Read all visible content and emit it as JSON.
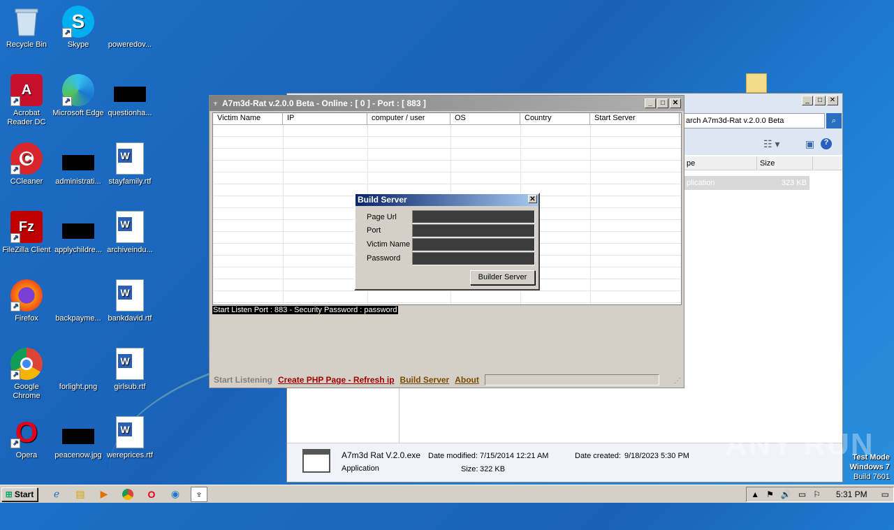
{
  "desktop": {
    "icons": [
      {
        "id": "recycle-bin",
        "label": "Recycle Bin"
      },
      {
        "id": "skype",
        "label": "Skype"
      },
      {
        "id": "poweredov",
        "label": "poweredov..."
      },
      {
        "id": "acrobat",
        "label": "Acrobat Reader DC"
      },
      {
        "id": "edge",
        "label": "Microsoft Edge"
      },
      {
        "id": "questionha",
        "label": "questionha..."
      },
      {
        "id": "ccleaner",
        "label": "CCleaner"
      },
      {
        "id": "administrati",
        "label": "administrati..."
      },
      {
        "id": "stayfamily",
        "label": "stayfamily.rtf"
      },
      {
        "id": "filezilla",
        "label": "FileZilla Client"
      },
      {
        "id": "applychildre",
        "label": "applychildre..."
      },
      {
        "id": "archiveindu",
        "label": "archiveindu..."
      },
      {
        "id": "firefox",
        "label": "Firefox"
      },
      {
        "id": "backpayme",
        "label": "backpayme..."
      },
      {
        "id": "bankdavid",
        "label": "bankdavid.rtf"
      },
      {
        "id": "chrome",
        "label": "Google Chrome"
      },
      {
        "id": "forlight",
        "label": "forlight.png"
      },
      {
        "id": "girlsub",
        "label": "girlsub.rtf"
      },
      {
        "id": "opera",
        "label": "Opera"
      },
      {
        "id": "peacenow",
        "label": "peacenow.jpg"
      },
      {
        "id": "wereprices",
        "label": "wereprices.rtf"
      }
    ]
  },
  "explorer": {
    "search_placeholder": "arch A7m3d-Rat v.2.0.0 Beta",
    "col_type": "pe",
    "col_size": "Size",
    "row_type": "plication",
    "row_size": "323 KB",
    "details": {
      "name": "A7m3d Rat V.2.0.exe",
      "type": "Application",
      "date_modified_label": "Date modified:",
      "date_modified": "7/15/2014 12:21 AM",
      "size_label": "Size:",
      "size": "322 KB",
      "date_created_label": "Date created:",
      "date_created": "9/18/2023 5:30 PM"
    }
  },
  "rat": {
    "title": "A7m3d-Rat v.2.0.0 Beta - Online : [ 0 ] - Port : [ 883 ]",
    "columns": [
      "Victim Name",
      "IP",
      "computer / user",
      "OS",
      "Country",
      "Start Server"
    ],
    "status": "Start Listen Port : 883 - Security Password : password",
    "menu": {
      "start": "Start Listening",
      "php": "Create PHP Page - Refresh ip",
      "build": "Build Server",
      "about": "About"
    }
  },
  "build_dialog": {
    "title": "Build Server",
    "fields": [
      "Page Url",
      "Port",
      "Victim Name",
      "Password"
    ],
    "button": "Builder Server"
  },
  "watermark": {
    "text": "ANY RUN",
    "test_mode": "Test Mode",
    "os": "Windows 7",
    "build": "Build 7601"
  },
  "taskbar": {
    "start": "Start",
    "clock": "5:31 PM"
  }
}
